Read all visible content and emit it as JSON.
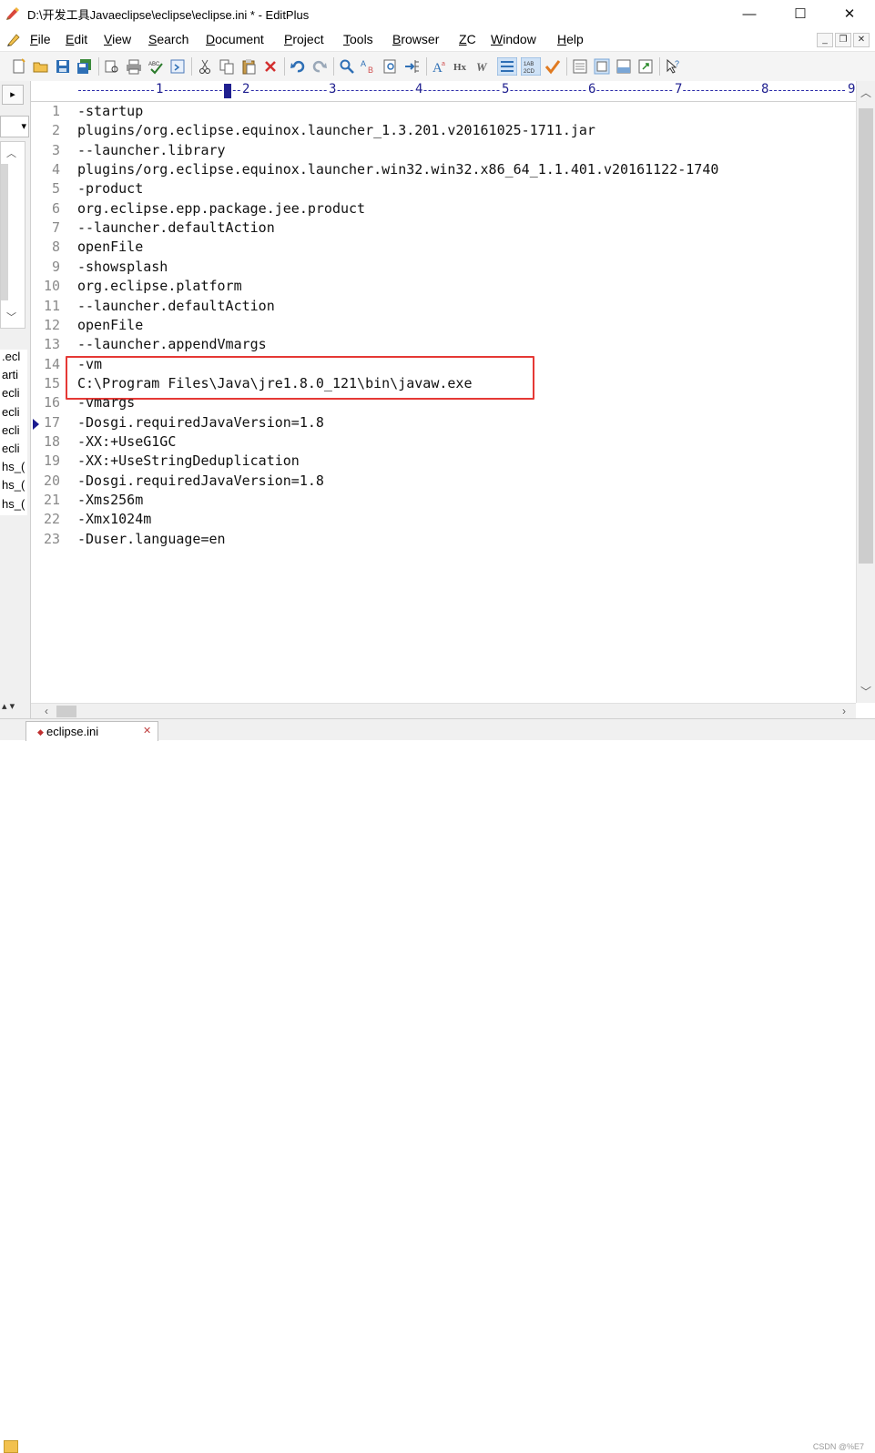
{
  "window": {
    "title": "D:\\开发工具Javaeclipse\\eclipse\\eclipse.ini * - EditPlus",
    "minimize": "—",
    "maximize": "☐",
    "close": "✕"
  },
  "menu": {
    "items": [
      {
        "label": "File",
        "u": "F",
        "rest": "ile"
      },
      {
        "label": "Edit",
        "u": "E",
        "rest": "dit"
      },
      {
        "label": "View",
        "u": "V",
        "rest": "iew"
      },
      {
        "label": "Search",
        "u": "S",
        "rest": "earch"
      },
      {
        "label": "Document",
        "u": "D",
        "rest": "ocument"
      },
      {
        "label": "Project",
        "u": "P",
        "rest": "roject"
      },
      {
        "label": "Tools",
        "u": "T",
        "rest": "ools"
      },
      {
        "label": "Browser",
        "u": "B",
        "rest": "rowser"
      },
      {
        "label": "ZC",
        "u": "Z",
        "rest": "C"
      },
      {
        "label": "Window",
        "u": "W",
        "rest": "indow"
      },
      {
        "label": "Help",
        "u": "H",
        "rest": "elp"
      }
    ]
  },
  "ruler": {
    "numbers": [
      "1",
      "2",
      "3",
      "4",
      "5",
      "6",
      "7",
      "8",
      "9"
    ]
  },
  "editor": {
    "lines": [
      {
        "n": "1",
        "text": "-startup"
      },
      {
        "n": "2",
        "text": "plugins/org.eclipse.equinox.launcher_1.3.201.v20161025-1711.jar"
      },
      {
        "n": "3",
        "text": "--launcher.library"
      },
      {
        "n": "4",
        "text": "plugins/org.eclipse.equinox.launcher.win32.win32.x86_64_1.1.401.v20161122-1740"
      },
      {
        "n": "5",
        "text": "-product"
      },
      {
        "n": "6",
        "text": "org.eclipse.epp.package.jee.product"
      },
      {
        "n": "7",
        "text": "--launcher.defaultAction"
      },
      {
        "n": "8",
        "text": "openFile"
      },
      {
        "n": "9",
        "text": "-showsplash"
      },
      {
        "n": "10",
        "text": "org.eclipse.platform"
      },
      {
        "n": "11",
        "text": "--launcher.defaultAction"
      },
      {
        "n": "12",
        "text": "openFile"
      },
      {
        "n": "13",
        "text": "--launcher.appendVmargs"
      },
      {
        "n": "14",
        "text": "-vm"
      },
      {
        "n": "15",
        "text": "C:\\Program Files\\Java\\jre1.8.0_121\\bin\\javaw.exe"
      },
      {
        "n": "16",
        "text": "-vmargs"
      },
      {
        "n": "17",
        "text": "-Dosgi.requiredJavaVersion=1.8"
      },
      {
        "n": "18",
        "text": "-XX:+UseG1GC"
      },
      {
        "n": "19",
        "text": "-XX:+UseStringDeduplication"
      },
      {
        "n": "20",
        "text": "-Dosgi.requiredJavaVersion=1.8"
      },
      {
        "n": "21",
        "text": "-Xms256m"
      },
      {
        "n": "22",
        "text": "-Xmx1024m"
      },
      {
        "n": "23",
        "text": "-Duser.language=en"
      }
    ]
  },
  "left_pane": {
    "files": [
      ".ecl",
      "arti",
      "ecli",
      "ecli",
      "ecli",
      "ecli",
      "hs_(",
      "hs_(",
      "hs_("
    ]
  },
  "tabs": [
    {
      "label": "eclipse.ini",
      "close": "✕"
    }
  ],
  "watermark": "CSDN @%E7"
}
